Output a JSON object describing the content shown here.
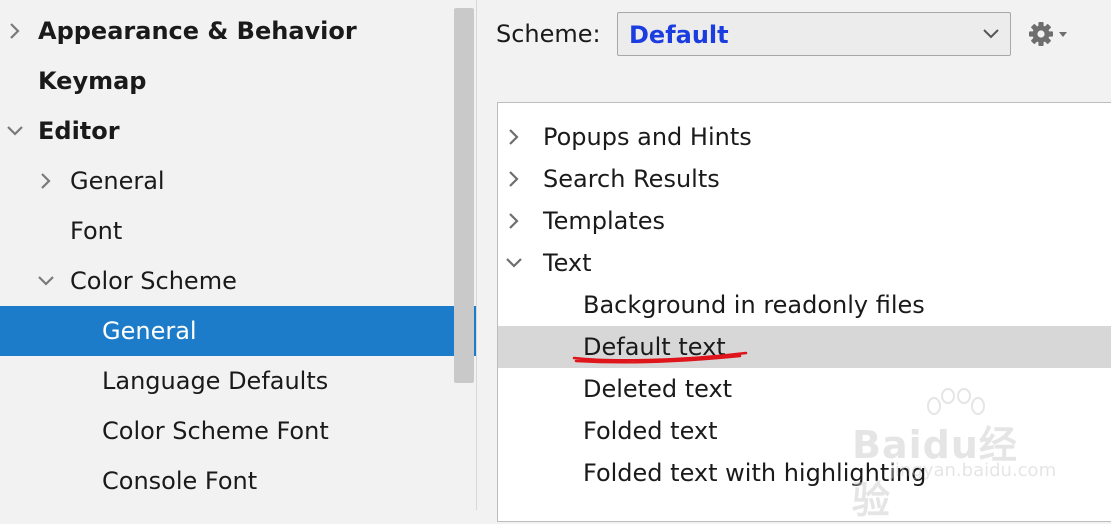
{
  "sidebar": {
    "items": [
      {
        "label": "Appearance & Behavior",
        "level": 0,
        "expander": "collapsed",
        "bold": true,
        "selected": false
      },
      {
        "label": "Keymap",
        "level": 0,
        "expander": "none",
        "bold": true,
        "selected": false
      },
      {
        "label": "Editor",
        "level": 0,
        "expander": "expanded",
        "bold": true,
        "selected": false
      },
      {
        "label": "General",
        "level": 1,
        "expander": "collapsed",
        "bold": false,
        "selected": false
      },
      {
        "label": "Font",
        "level": 1,
        "expander": "none",
        "bold": false,
        "selected": false
      },
      {
        "label": "Color Scheme",
        "level": 1,
        "expander": "expanded",
        "bold": false,
        "selected": false
      },
      {
        "label": "General",
        "level": 2,
        "expander": "none",
        "bold": false,
        "selected": true
      },
      {
        "label": "Language Defaults",
        "level": 2,
        "expander": "none",
        "bold": false,
        "selected": false
      },
      {
        "label": "Color Scheme Font",
        "level": 2,
        "expander": "none",
        "bold": false,
        "selected": false
      },
      {
        "label": "Console Font",
        "level": 2,
        "expander": "none",
        "bold": false,
        "selected": false
      }
    ]
  },
  "scheme": {
    "label": "Scheme:",
    "value": "Default",
    "dropdown_icon": "chevron-down-icon",
    "settings_icon": "gear-icon"
  },
  "tree": {
    "items": [
      {
        "label": "Popups and Hints",
        "level": 0,
        "expander": "collapsed",
        "selected": false
      },
      {
        "label": "Search Results",
        "level": 0,
        "expander": "collapsed",
        "selected": false
      },
      {
        "label": "Templates",
        "level": 0,
        "expander": "collapsed",
        "selected": false
      },
      {
        "label": "Text",
        "level": 0,
        "expander": "expanded",
        "selected": false
      },
      {
        "label": "Background in readonly files",
        "level": 1,
        "expander": "none",
        "selected": false
      },
      {
        "label": "Default text",
        "level": 1,
        "expander": "none",
        "selected": true
      },
      {
        "label": "Deleted text",
        "level": 1,
        "expander": "none",
        "selected": false
      },
      {
        "label": "Folded text",
        "level": 1,
        "expander": "none",
        "selected": false
      },
      {
        "label": "Folded text with highlighting",
        "level": 1,
        "expander": "none",
        "selected": false
      }
    ]
  },
  "watermark": {
    "logo": "Baidu经验",
    "url": "jingyan.baidu.com"
  },
  "colors": {
    "selection_blue": "#1d7cc9",
    "tree_selection": "#d7d7d7",
    "scheme_value": "#1b3de0",
    "annotation_red": "#e0141b"
  }
}
